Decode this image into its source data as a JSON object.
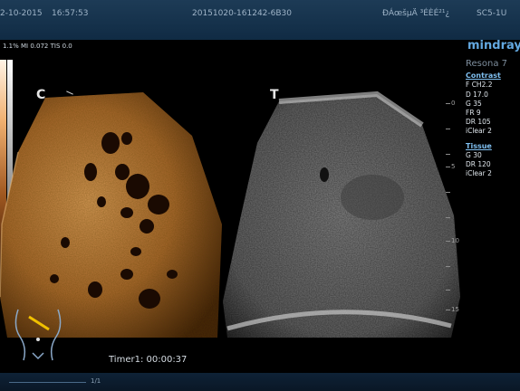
{
  "header": {
    "date": "2-10-2015",
    "time": "16:57:53",
    "exam_id": "20151020-161242-6B30",
    "garbled": "ÐÁœšµÄ ³ÉÈÉ²¹¿",
    "probe": "SC5-1U"
  },
  "subinfo": "1.1%  MI 0.072  TIS 0.0",
  "brand": {
    "logo": "mindray",
    "model": "Resona 7"
  },
  "contrast": {
    "title": "Contrast",
    "params": [
      "F CH2.2",
      "D 17.0",
      "G 35",
      "FR 9",
      "DR 105",
      "iClear 2"
    ]
  },
  "tissue": {
    "title": "Tissue",
    "params": [
      "G 30",
      "DR 120",
      "iClear 2"
    ]
  },
  "images": {
    "left_label": "C",
    "right_label": "T"
  },
  "depth_labels": [
    "0",
    "5",
    "10",
    "15"
  ],
  "timer": "Timer1: 00:00:37",
  "frame": "1/1",
  "colors": {
    "contrast_tint": "#c58a4a",
    "ui_blue": "#7fbff0"
  }
}
